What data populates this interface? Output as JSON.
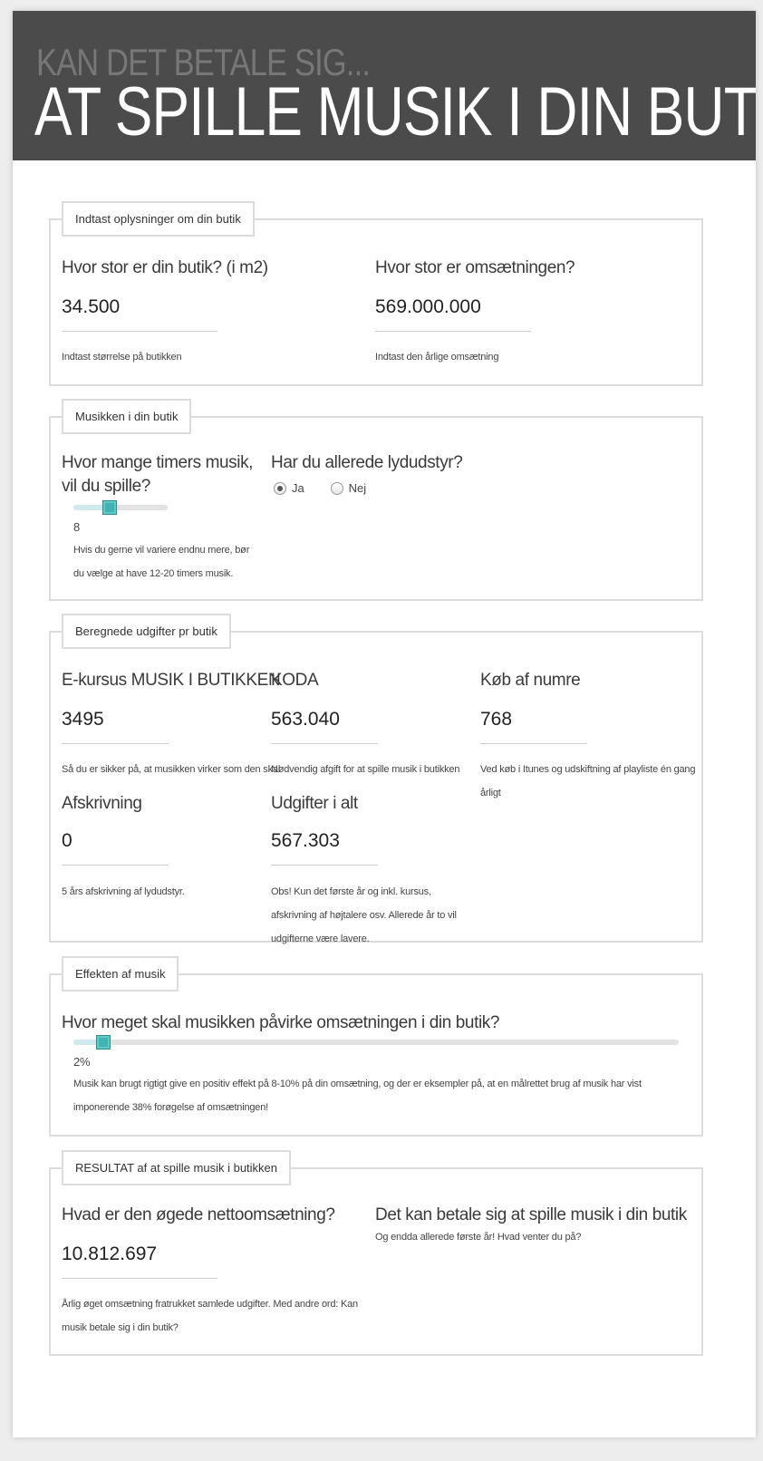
{
  "header": {
    "subtitle": "KAN DET BETALE SIG...",
    "title": "AT SPILLE MUSIK I DIN BUTIK?"
  },
  "shop_info": {
    "legend": "Indtast oplysninger om din butik",
    "size": {
      "question": "Hvor stor er din butik? (i m2)",
      "value": "34.500",
      "help": "Indtast størrelse på butikken"
    },
    "revenue": {
      "question": "Hvor stor er omsætningen?",
      "value": "569.000.000",
      "help": "Indtast den årlige omsætning"
    }
  },
  "music": {
    "legend": "Musikken i din butik",
    "hours": {
      "question": "Hvor mange timers musik, vil du spille?",
      "slider_value": 8,
      "slider_fraction": 0.38,
      "value_label": "8",
      "help": "Hvis du gerne vil variere endnu mere, bør du vælge at have 12-20 timers musik."
    },
    "sound": {
      "question": "Har du allerede lydudstyr?",
      "options": [
        "Ja",
        "Nej"
      ],
      "selected": "Ja"
    }
  },
  "costs": {
    "legend": "Beregnede udgifter pr butik",
    "ecourse": {
      "title": "E-kursus MUSIK I BUTIKKEN",
      "value": "3495",
      "help": "Så du er sikker på, at musikken virker som den skal"
    },
    "koda": {
      "title": "KODA",
      "value": "563.040",
      "help": "Nødvendig afgift for at spille musik i butikken"
    },
    "tracks": {
      "title": "Køb af numre",
      "value": "768",
      "help": "Ved køb i Itunes og udskiftning af playliste én gang årligt"
    },
    "depreciation": {
      "title": "Afskrivning",
      "value": "0",
      "help": "5 års afskrivning af lydudstyr."
    },
    "total": {
      "title": "Udgifter i alt",
      "value": "567.303",
      "help": "Obs! Kun det første år og inkl. kursus, afskrivning af højtalere osv. Allerede år to vil udgifterne være lavere."
    }
  },
  "effect": {
    "legend": "Effekten af musik",
    "question": "Hvor meget skal musikken påvirke omsætningen i din butik?",
    "slider_value_percent": 2,
    "slider_fraction": 0.05,
    "value_label": "2%",
    "help": "Musik kan brugt rigtigt give en positiv effekt på 8-10% på din omsætning, og der er eksempler på, at en målrettet brug af musik har vist imponerende 38% forøgelse af omsætningen!"
  },
  "result": {
    "legend": "RESULTAT af at spille musik i butikken",
    "net": {
      "question": "Hvad er den øgede nettoomsætning?",
      "value": "10.812.697",
      "help": "Årlig øget omsætning fratrukket samlede udgifter. Med andre ord: Kan musik betale sig i din butik?"
    },
    "conclusion": {
      "title": "Det kan betale sig at spille musik i din butik",
      "text": "Og endda allerede første år! Hvad venter du på?"
    }
  },
  "colors": {
    "header_bg": "#4b4b4b",
    "slider_thumb": "#3fb4b2",
    "border": "#dcdcdc"
  }
}
